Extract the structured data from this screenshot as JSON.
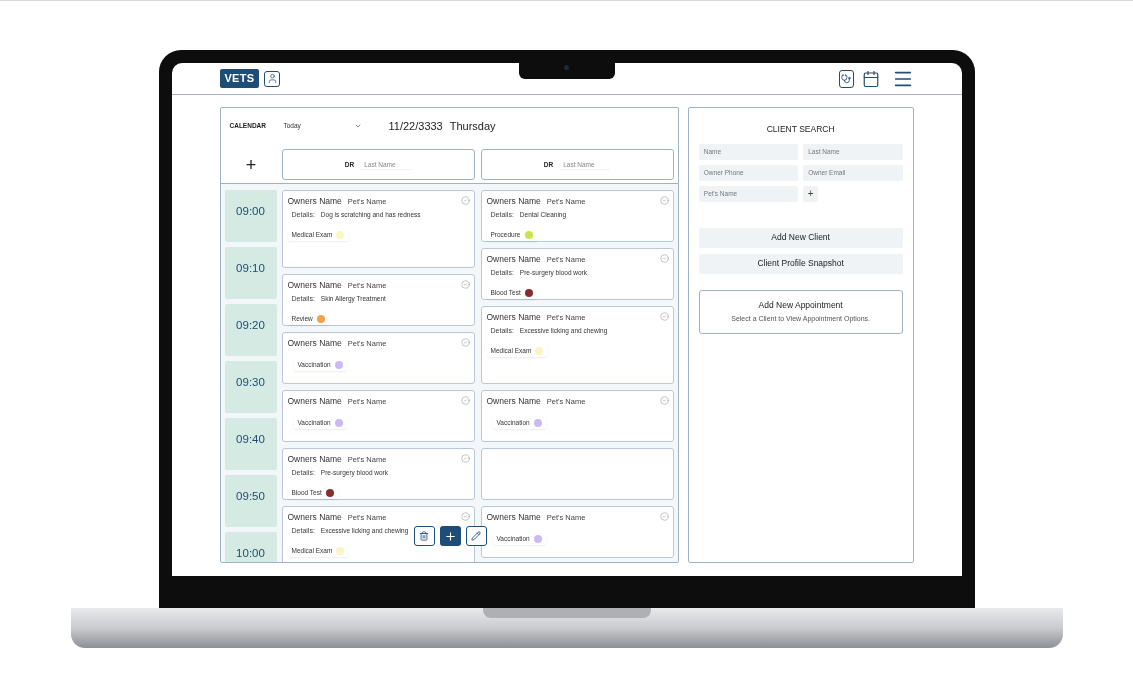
{
  "header": {
    "logo": "VETS"
  },
  "calendar": {
    "label": "CALENDAR",
    "range": "Today",
    "date": "11/22/3333",
    "weekday": "Thursday",
    "add_symbol": "+",
    "doctors": [
      {
        "prefix": "DR",
        "placeholder": "Last Name"
      },
      {
        "prefix": "DR",
        "placeholder": "Last Name"
      }
    ],
    "times": [
      "09:00",
      "09:10",
      "09:20",
      "09:30",
      "09:40",
      "09:50",
      "10:00"
    ],
    "columns": [
      [
        {
          "kind": "long_appointment",
          "owner": "Owners Name",
          "pet": "Pet's Name",
          "details_label": "Details:",
          "details": "Dog is scratching and has redness",
          "tag": {
            "label": "Medical Exam",
            "color": "#fdf4c4"
          }
        },
        {
          "kind": "appointment",
          "owner": "Owners Name",
          "pet": "Pet's Name",
          "details_label": "Details:",
          "details": "Skin Allergy Treatment",
          "tag": {
            "label": "Review",
            "color": "#f4a14a"
          }
        },
        {
          "kind": "appointment",
          "owner": "Owners Name",
          "pet": "Pet's Name",
          "tag": {
            "label": "Vaccination",
            "color": "#cdb8f6"
          }
        },
        {
          "kind": "appointment",
          "owner": "Owners Name",
          "pet": "Pet's Name",
          "tag": {
            "label": "Vaccination",
            "color": "#cdb8f6"
          }
        },
        {
          "kind": "appointment",
          "owner": "Owners Name",
          "pet": "Pet's Name",
          "details_label": "Details:",
          "details": "Pre-surgery blood work",
          "tag": {
            "label": "Blood Test",
            "color": "#8b2c2c"
          }
        },
        {
          "kind": "long_appointment",
          "owner": "Owners Name",
          "pet": "Pet's Name",
          "details_label": "Details:",
          "details": "Excessive licking and chewing",
          "tag": {
            "label": "Medical Exam",
            "color": "#fdf4c4"
          }
        }
      ],
      [
        {
          "kind": "appointment",
          "owner": "Owners Name",
          "pet": "Pet's Name",
          "details_label": "Details:",
          "details": "Dental Cleaning",
          "tag": {
            "label": "Procedure",
            "color": "#c8e64c"
          }
        },
        {
          "kind": "appointment",
          "owner": "Owners Name",
          "pet": "Pet's Name",
          "details_label": "Details:",
          "details": "Pre-surgery blood work",
          "tag": {
            "label": "Blood Test",
            "color": "#8b2c2c"
          }
        },
        {
          "kind": "long_appointment",
          "owner": "Owners Name",
          "pet": "Pet's Name",
          "details_label": "Details:",
          "details": "Excessive licking and chewing",
          "tag": {
            "label": "Medical Exam",
            "color": "#fdf4c4"
          }
        },
        {
          "kind": "appointment",
          "owner": "Owners Name",
          "pet": "Pet's Name",
          "tag": {
            "label": "Vaccination",
            "color": "#cdb8f6"
          }
        },
        {
          "kind": "empty"
        },
        {
          "kind": "appointment",
          "owner": "Owners Name",
          "pet": "Pet's Name",
          "tag": {
            "label": "Vaccination",
            "color": "#cdb8f6"
          }
        }
      ]
    ]
  },
  "client_search": {
    "title": "CLIENT SEARCH",
    "fields": [
      {
        "placeholder": "Name"
      },
      {
        "placeholder": "Last Name"
      },
      {
        "placeholder": "Owner Phone"
      },
      {
        "placeholder": "Owner Email"
      },
      {
        "placeholder": "Pet's Name"
      }
    ],
    "add_symbol": "+",
    "buttons": [
      "Add New Client",
      "Client Profile Snapshot"
    ],
    "appointment_card": {
      "title": "Add New Appointment",
      "subtitle": "Select a Client to View Appointment Options."
    }
  }
}
